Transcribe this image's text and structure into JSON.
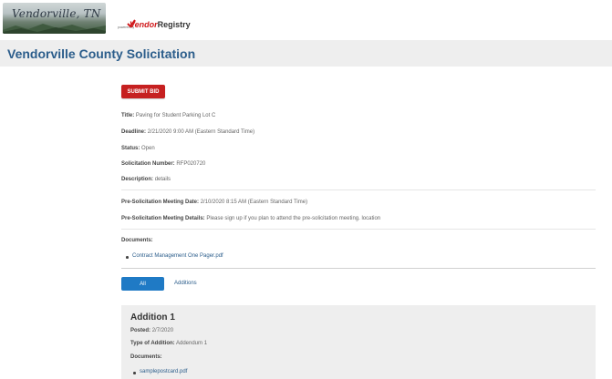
{
  "header": {
    "logo_text": "Vendorville, TN",
    "powered_by": "powered by",
    "brand_vendor": "Vendor",
    "brand_registry": "Registry"
  },
  "page": {
    "title": "Vendorville County Solicitation"
  },
  "actions": {
    "submit_bid": "SUBMIT BID"
  },
  "solicitation": {
    "title_label": "Title:",
    "title_value": "Paving for Student Parking Lot C",
    "deadline_label": "Deadline:",
    "deadline_value": "2/21/2020 9:00 AM (Eastern Standard Time)",
    "status_label": "Status:",
    "status_value": "Open",
    "number_label": "Solicitation Number:",
    "number_value": "RFP020720",
    "description_label": "Description:",
    "description_value": "details",
    "meeting_date_label": "Pre-Solicitation Meeting Date:",
    "meeting_date_value": "2/10/2020 8:15 AM (Eastern Standard Time)",
    "meeting_details_label": "Pre-Solicitation Meeting Details:",
    "meeting_details_value": "Please sign up if you plan to attend the pre-solicitation meeting. location"
  },
  "documents": {
    "label": "Documents:",
    "items": [
      "Contract Management One Pager.pdf"
    ]
  },
  "tabs": {
    "all": "All",
    "additions": "Additions"
  },
  "addition": {
    "title": "Addition 1",
    "posted_label": "Posted:",
    "posted_value": "2/7/2020",
    "type_label": "Type of Addition:",
    "type_value": "Addendum 1",
    "documents_label": "Documents:",
    "documents": [
      "samplepostcard.pdf"
    ]
  },
  "colors": {
    "accent_blue": "#1f7ac5",
    "link_blue": "#2b5d8b",
    "submit_red": "#c62020",
    "panel_gray": "#eeeeee"
  }
}
